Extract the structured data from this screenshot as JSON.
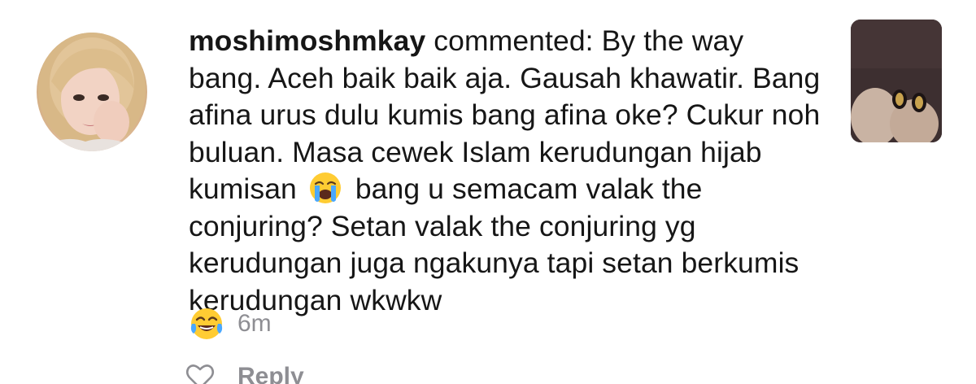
{
  "comment": {
    "username": "moshimoshmkay",
    "verb": "commented:",
    "text_before_emoji": "By the way bang. Aceh baik baik aja. Gausah khawatir. Bang afina urus dulu kumis bang afina oke? Cukur noh buluan. Masa cewek Islam kerudungan hijab kumisan",
    "inline_emoji": "loudly-crying-face-emoji",
    "text_after_emoji": "bang u semacam valak the conjuring? Setan valak the conjuring yg kerudungan juga ngakunya tapi setan berkumis kerudungan wkwkw",
    "trailing_emoji": "face-with-tears-of-joy-emoji",
    "time": "6m"
  },
  "actions": {
    "like_icon": "heart-outline-icon",
    "reply_label": "Reply"
  },
  "colors": {
    "text": "#161616",
    "muted": "#8e8e93",
    "background": "#ffffff"
  }
}
